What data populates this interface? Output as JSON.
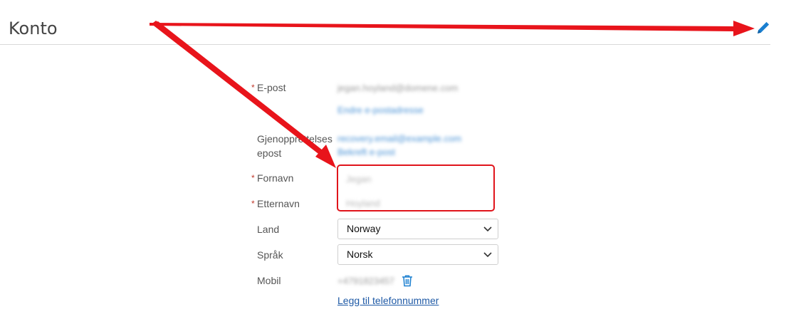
{
  "header": {
    "title": "Konto"
  },
  "form": {
    "email": {
      "label": "E-post",
      "required_mark": "*",
      "value": "jegan.hoyland@domene.com",
      "link": "Endre e-postadresse"
    },
    "recovery_email": {
      "label_line1": "Gjenopprettelses",
      "label_line2": "epost",
      "value_line1": "recovery.email@example.com",
      "value_line2": "Bekreft e-post"
    },
    "first_name": {
      "label": "Fornavn",
      "required_mark": "*",
      "value": "Jegan"
    },
    "last_name": {
      "label": "Etternavn",
      "required_mark": "*",
      "value": "Hoyland"
    },
    "country": {
      "label": "Land",
      "selected": "Norway"
    },
    "language": {
      "label": "Språk",
      "selected": "Norsk"
    },
    "mobile": {
      "label": "Mobil",
      "value": "+4791823457"
    },
    "add_phone": {
      "label": "Legg til telefonnummer"
    }
  },
  "colors": {
    "accent": "#1f5aa6",
    "annotation": "#e0141b",
    "required": "#c0392b"
  },
  "icons": {
    "edit": "pencil-icon",
    "delete": "trash-icon",
    "dropdown": "chevron-down-icon"
  }
}
